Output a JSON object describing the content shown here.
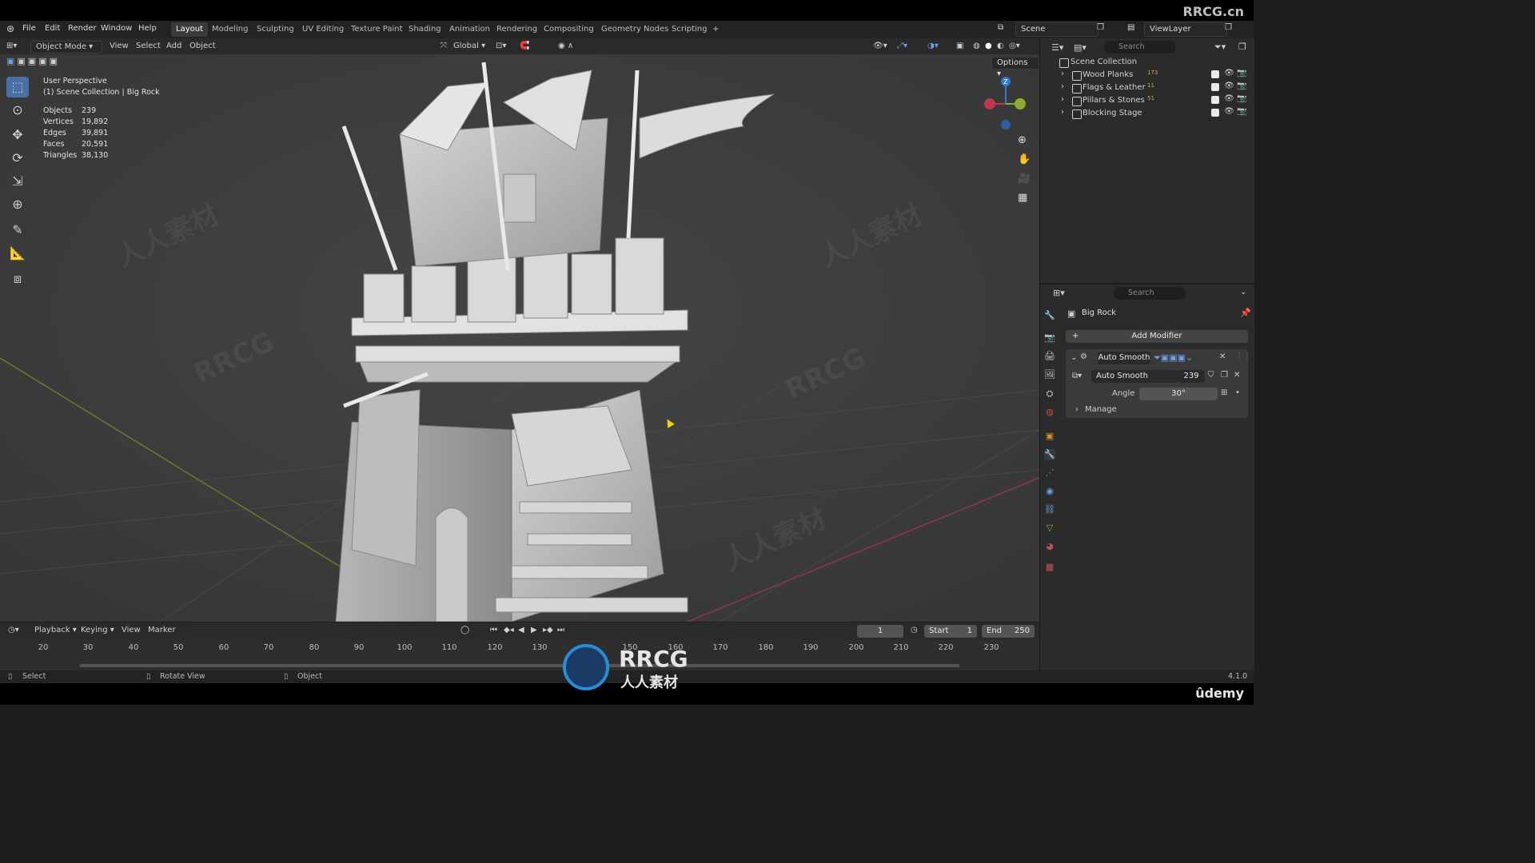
{
  "menu": [
    "File",
    "Edit",
    "Render",
    "Window",
    "Help"
  ],
  "workspaces": [
    "Layout",
    "Modeling",
    "Sculpting",
    "UV Editing",
    "Texture Paint",
    "Shading",
    "Animation",
    "Rendering",
    "Compositing",
    "Geometry Nodes",
    "Scripting",
    "+"
  ],
  "active_workspace": "Layout",
  "scene": "Scene",
  "view_layer": "ViewLayer",
  "watermark_top": "RRCG.cn",
  "viewport_header": {
    "mode": "Object Mode",
    "menus": [
      "View",
      "Select",
      "Add",
      "Object"
    ],
    "transform_orientation": "Global",
    "options": "Options"
  },
  "overlay": {
    "title": "User Perspective",
    "collection": "(1) Scene Collection | Big Rock",
    "stats": [
      {
        "label": "Objects",
        "value": "239"
      },
      {
        "label": "Vertices",
        "value": "19,892"
      },
      {
        "label": "Edges",
        "value": "39,891"
      },
      {
        "label": "Faces",
        "value": "20,591"
      },
      {
        "label": "Triangles",
        "value": "38,130"
      }
    ]
  },
  "outliner": {
    "search_placeholder": "Search",
    "root": "Scene Collection",
    "collections": [
      {
        "name": "Wood Planks",
        "badge": "173"
      },
      {
        "name": "Flags & Leather",
        "badge": "11"
      },
      {
        "name": "Pillars & Stones",
        "badge": "51"
      },
      {
        "name": "Blocking Stage",
        "badge": ""
      }
    ]
  },
  "properties": {
    "search_placeholder": "Search",
    "object_name": "Big Rock",
    "add_modifier": "Add Modifier",
    "modifier_name": "Auto Smooth",
    "node_group": "Auto Smooth",
    "node_group_users": "239",
    "angle_label": "Angle",
    "angle_value": "30°",
    "manage": "Manage"
  },
  "timeline": {
    "menus": [
      "Playback",
      "Keying",
      "View",
      "Marker"
    ],
    "current_frame": "1",
    "start_label": "Start",
    "start": "1",
    "end_label": "End",
    "end": "250",
    "ticks": [
      "20",
      "30",
      "40",
      "50",
      "60",
      "70",
      "80",
      "90",
      "100",
      "110",
      "120",
      "130",
      "150",
      "160",
      "170",
      "180",
      "190",
      "200",
      "210",
      "220",
      "230"
    ]
  },
  "statusbar": {
    "select": "Select",
    "rotate": "Rotate View",
    "object": "Object",
    "version": "4.1.0"
  },
  "brand": {
    "logo_latin": "RRCG",
    "logo_cjk": "人人素材",
    "udemy": "ûdemy"
  },
  "colors": {
    "accent": "#4a6fa5",
    "viewport_bg": "#3d3d3d",
    "axis_x": "#c0394b",
    "axis_y": "#8cae2c",
    "axis_z": "#2f78d6"
  }
}
